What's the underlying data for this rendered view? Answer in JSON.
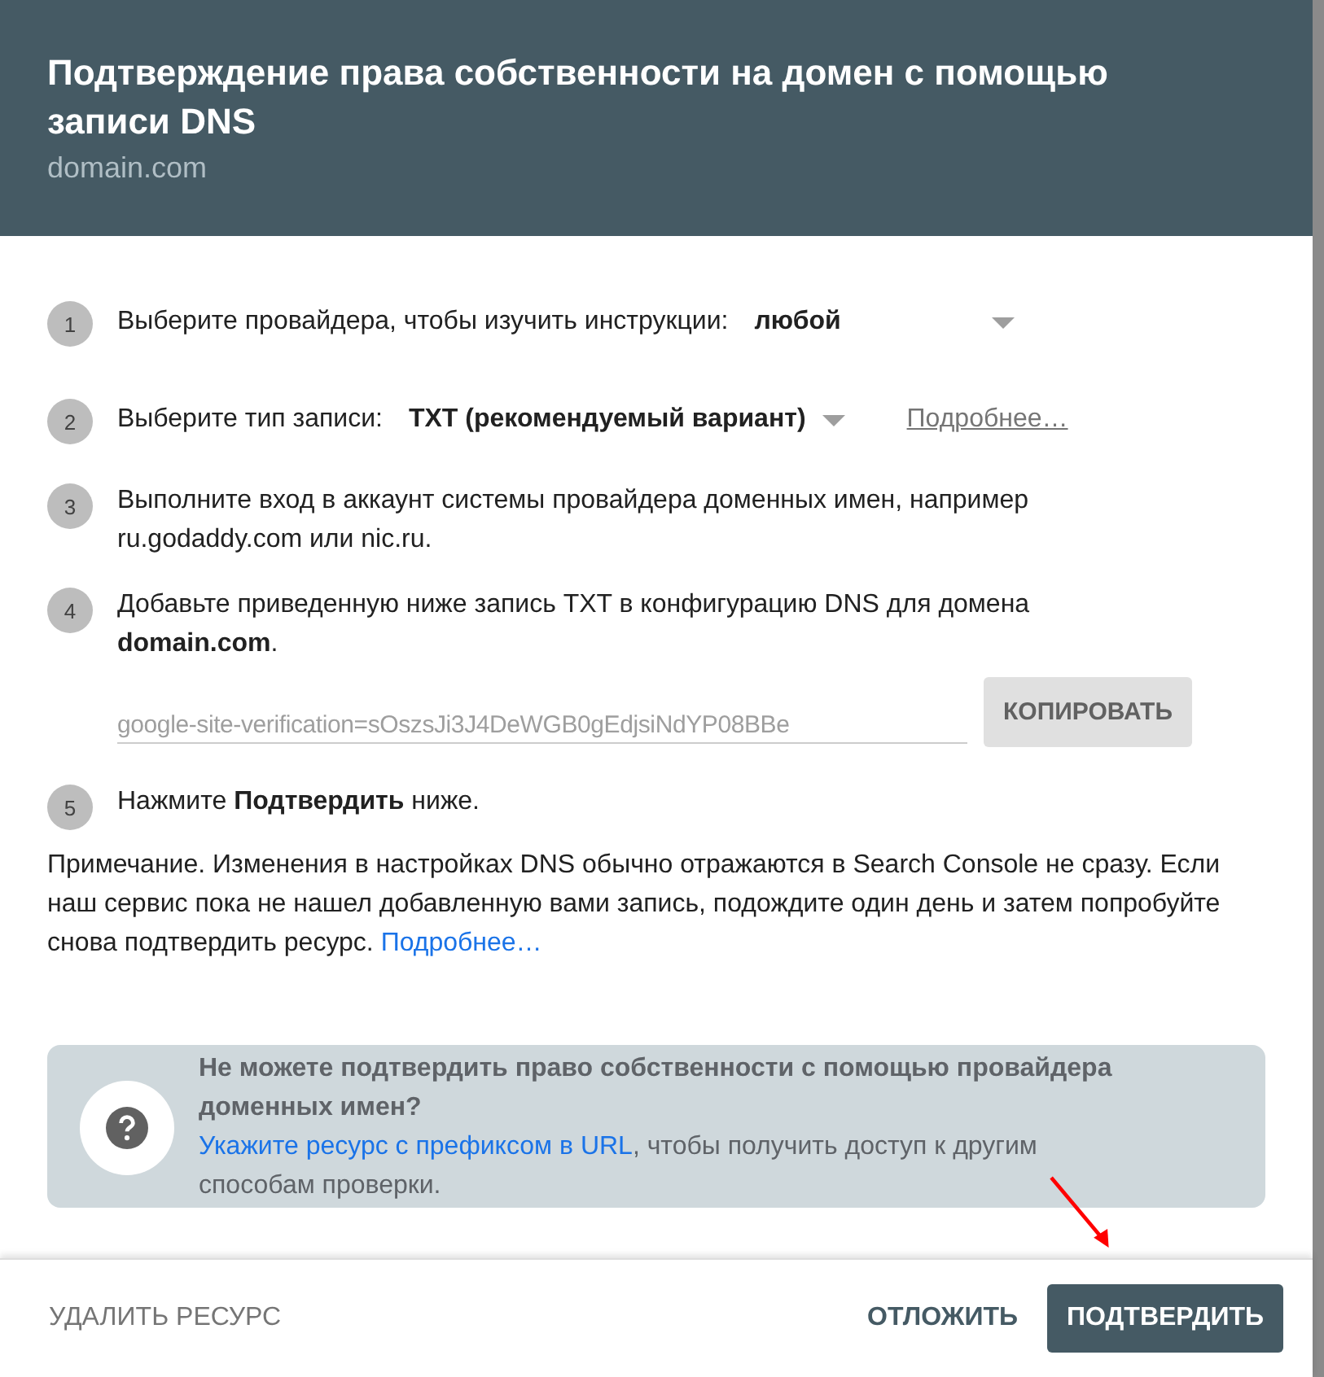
{
  "dialog": {
    "title": "Подтверждение права собственности на домен с помощью записи DNS",
    "subtitle": "domain.com"
  },
  "steps": [
    {
      "number": "1",
      "kind": "select",
      "text": "Выберите провайдера, чтобы изучить инструкции:",
      "value": "любой"
    },
    {
      "number": "2",
      "kind": "select",
      "text": "Выберите тип записи:",
      "value": "TXT (рекомендуемый вариант)",
      "link": "Подробнее…"
    },
    {
      "number": "3",
      "kind": "text",
      "text": "Выполните вход в аккаунт системы провайдера доменных имен, например ru.godaddy.com или nic.ru."
    },
    {
      "number": "4",
      "kind": "text",
      "text": "Добавьте приведенную ниже запись TXT в конфигурацию DNS для домена **domain.com**.",
      "record": {
        "value": "google-site-verification=sOszsJi3J4DeWGB0gEdjsiNdYP08BBe",
        "button": "КОПИРОВАТЬ"
      }
    },
    {
      "number": "5",
      "kind": "text",
      "text": "Нажмите **Подтвердить** ниже."
    }
  ],
  "note": {
    "text": "Примечание. Изменения в настройках DNS обычно отражаются в Search Console не сразу. Если наш сервис пока не нашел добавленную вами запись, подождите один день и затем попробуйте снова подтвердить ресурс.",
    "link": "Подробнее…"
  },
  "hint": {
    "title": "Не можете подтвердить право собственности с помощью провайдера доменных имен?",
    "link": "Укажите ресурс с префиксом в URL",
    "text": ", чтобы получить доступ к другим способам проверки."
  },
  "footer": {
    "buttons": [
      {
        "label": "УДАЛИТЬ РЕСУРС",
        "kind": "text"
      },
      {
        "label": "ОТЛОЖИТЬ",
        "kind": "text"
      },
      {
        "label": "ПОДТВЕРДИТЬ",
        "kind": "primary"
      }
    ]
  },
  "annotation": {
    "kind": "arrow"
  }
}
